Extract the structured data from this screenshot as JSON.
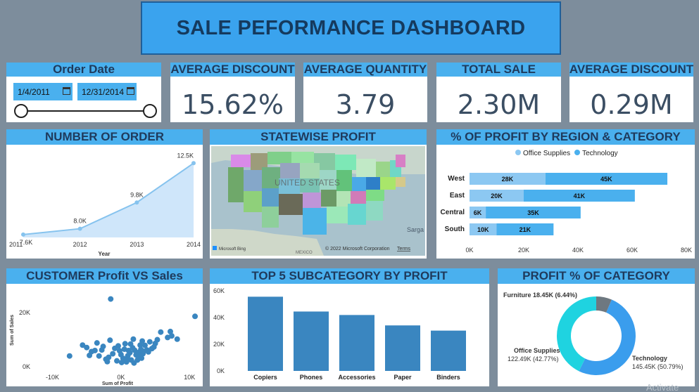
{
  "title": "SALE PEFORMANCE DASHBOARD",
  "order_date": {
    "label": "Order Date",
    "start": "1/4/2011",
    "end": "12/31/2014"
  },
  "kpis": [
    {
      "label": "AVERAGE DISCOUNT",
      "value": "15.62%"
    },
    {
      "label": "AVERAGE QUANTITY",
      "value": "3.79"
    },
    {
      "label": "TOTAL SALE",
      "value": "2.30M"
    },
    {
      "label": "AVERAGE DISCOUNT",
      "value": "0.29M"
    }
  ],
  "colors": {
    "header": "#4ab0ee",
    "office": "#8cc8f2",
    "technology": "#4ab0ee",
    "bars": "#3a86c0",
    "furniture": "#6e7880",
    "donut_office": "#1fd3e0",
    "donut_tech": "#3a9ded"
  },
  "map": {
    "title": "STATEWISE PROFIT",
    "country_label": "UNITED STATES",
    "ocean_label": "Sarga",
    "mexico_label": "MEXICO",
    "attribution": "© 2022 Microsoft Corporation",
    "terms": "Terms",
    "logo": "Microsoft Bing"
  },
  "chart_data": [
    {
      "id": "orders",
      "type": "area",
      "title": "NUMBER OF ORDER",
      "xlabel": "Year",
      "x": [
        "2011",
        "2012",
        "2013",
        "2014"
      ],
      "values": [
        7.6,
        8.0,
        9.8,
        12.5
      ],
      "labels": [
        "7.6K",
        "8.0K",
        "9.8K",
        "12.5K"
      ],
      "ylim": [
        7.4,
        12.9
      ]
    },
    {
      "id": "region",
      "type": "bar",
      "title": "% OF PROFIT BY REGION & CATEGORY",
      "categories": [
        "West",
        "East",
        "Central",
        "South"
      ],
      "series": [
        {
          "name": "Office Supplies",
          "values": [
            28,
            20,
            6,
            10
          ],
          "labels": [
            "28K",
            "20K",
            "6K",
            "10K"
          ]
        },
        {
          "name": "Technology",
          "values": [
            45,
            41,
            35,
            21
          ],
          "labels": [
            "45K",
            "41K",
            "35K",
            "21K"
          ]
        }
      ],
      "xticks": [
        "0K",
        "20K",
        "40K",
        "60K",
        "80K"
      ],
      "xlim": [
        0,
        80
      ],
      "stacked": true,
      "orientation": "horizontal"
    },
    {
      "id": "scatter",
      "type": "scatter",
      "title": "CUSTOMER Profit VS Sales",
      "xlabel": "Sum of Profit",
      "ylabel": "Sum of Sales",
      "xticks": [
        "-10K",
        "0K",
        "10K"
      ],
      "yticks": [
        "0K",
        "20K"
      ],
      "xlim": [
        -12,
        11
      ],
      "ylim": [
        -1,
        28
      ],
      "points": [
        [
          -7.5,
          4
        ],
        [
          -3.8,
          6
        ],
        [
          -2.2,
          2.8
        ],
        [
          -1.5,
          25
        ],
        [
          0.5,
          6.5
        ],
        [
          0.8,
          1.8
        ],
        [
          1.3,
          5.2
        ],
        [
          1.7,
          7
        ],
        [
          2.2,
          4.4
        ],
        [
          2.8,
          8
        ],
        [
          3,
          3.2
        ],
        [
          3.8,
          6.2
        ],
        [
          4.2,
          9.2
        ],
        [
          4.8,
          7.3
        ],
        [
          5.3,
          10
        ],
        [
          5.8,
          12.8
        ],
        [
          6.8,
          10.8
        ],
        [
          7.4,
          11.4
        ],
        [
          7.2,
          13
        ],
        [
          8.2,
          10.2
        ],
        [
          10.8,
          18.6
        ],
        [
          -5.6,
          8
        ],
        [
          -5,
          7.1
        ],
        [
          -4.3,
          5.6
        ],
        [
          -3.2,
          4
        ],
        [
          -2.6,
          7.5
        ],
        [
          -1.8,
          3.5
        ],
        [
          -1.2,
          4.8
        ],
        [
          -0.6,
          2.2
        ],
        [
          -0.2,
          5.9
        ],
        [
          0.3,
          3.1
        ],
        [
          0.6,
          8.5
        ],
        [
          1,
          4.1
        ],
        [
          1.5,
          2.5
        ],
        [
          2,
          6.1
        ],
        [
          2.5,
          5.2
        ],
        [
          3.2,
          4.8
        ],
        [
          3.5,
          7.9
        ],
        [
          4,
          5.5
        ],
        [
          4.5,
          6.7
        ],
        [
          -3.5,
          8.8
        ],
        [
          -2.8,
          6.2
        ],
        [
          -0.9,
          6.8
        ],
        [
          0,
          4.5
        ],
        [
          1.1,
          6
        ],
        [
          2.4,
          2.5
        ],
        [
          3.1,
          9.5
        ],
        [
          -1.6,
          9.8
        ],
        [
          1.8,
          10.2
        ],
        [
          0.9,
          3.2
        ],
        [
          -2,
          1.9
        ],
        [
          2.7,
          3.9
        ],
        [
          -0.4,
          7.7
        ],
        [
          1.4,
          8.4
        ],
        [
          3.3,
          5.7
        ],
        [
          5,
          8.6
        ],
        [
          -4.6,
          4.2
        ],
        [
          0.1,
          1.6
        ],
        [
          1.9,
          1.4
        ],
        [
          2.9,
          6.4
        ]
      ]
    },
    {
      "id": "subcategory",
      "type": "bar",
      "title": "TOP 5 SUBCATEGORY BY PROFIT",
      "categories": [
        "Copiers",
        "Phones",
        "Accessories",
        "Paper",
        "Binders"
      ],
      "values": [
        55.6,
        44.5,
        41.9,
        34.1,
        30.2
      ],
      "yticks": [
        "0K",
        "20K",
        "40K",
        "60K"
      ],
      "ylim": [
        0,
        60
      ]
    },
    {
      "id": "category",
      "type": "pie",
      "title": "PROFIT % OF CATEGORY",
      "slices": [
        {
          "name": "Furniture",
          "value": 6.44,
          "label": "Furniture 18.45K (6.44%)"
        },
        {
          "name": "Technology",
          "value": 50.79,
          "label_line1": "Technology",
          "label_line2": "145.45K (50.79%)"
        },
        {
          "name": "Office Supplies",
          "value": 42.77,
          "label_line1": "Office Supplies",
          "label_line2": "122.49K (42.77%)"
        }
      ]
    }
  ],
  "watermark": "Activate"
}
